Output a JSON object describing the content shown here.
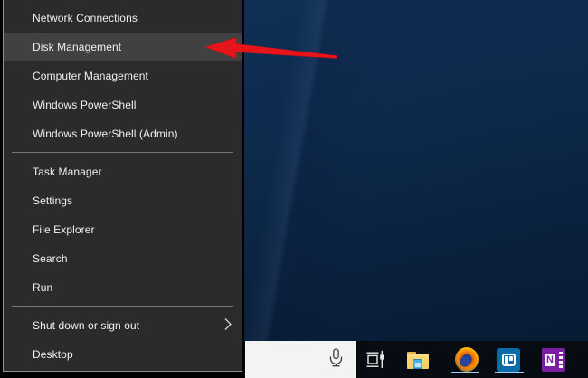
{
  "menu": {
    "groups": [
      {
        "items": [
          {
            "label": "Network Connections",
            "highlighted": false,
            "has_submenu": false
          },
          {
            "label": "Disk Management",
            "highlighted": true,
            "has_submenu": false
          },
          {
            "label": "Computer Management",
            "highlighted": false,
            "has_submenu": false
          },
          {
            "label": "Windows PowerShell",
            "highlighted": false,
            "has_submenu": false
          },
          {
            "label": "Windows PowerShell (Admin)",
            "highlighted": false,
            "has_submenu": false
          }
        ]
      },
      {
        "items": [
          {
            "label": "Task Manager",
            "highlighted": false,
            "has_submenu": false
          },
          {
            "label": "Settings",
            "highlighted": false,
            "has_submenu": false
          },
          {
            "label": "File Explorer",
            "highlighted": false,
            "has_submenu": false
          },
          {
            "label": "Search",
            "highlighted": false,
            "has_submenu": false
          },
          {
            "label": "Run",
            "highlighted": false,
            "has_submenu": false
          }
        ]
      },
      {
        "items": [
          {
            "label": "Shut down or sign out",
            "highlighted": false,
            "has_submenu": true
          },
          {
            "label": "Desktop",
            "highlighted": false,
            "has_submenu": false
          }
        ]
      }
    ]
  },
  "taskbar": {
    "search_box": {
      "icon": "microphone-icon"
    },
    "icons": [
      {
        "name": "task-view",
        "running": false
      },
      {
        "name": "file-explorer",
        "running": false
      },
      {
        "name": "firefox",
        "running": true
      },
      {
        "name": "trello",
        "running": true
      },
      {
        "name": "onenote",
        "running": false
      }
    ]
  },
  "annotation": {
    "type": "red-arrow",
    "points_to": "Disk Management"
  },
  "colors": {
    "menu_bg": "#2b2b2b",
    "menu_highlight": "#414141",
    "menu_text": "#f0f0f0",
    "menu_border": "#8f8f8f",
    "divider": "#777777",
    "desktop_blue_top": "#103158",
    "desktop_blue_bottom": "#081b33",
    "taskbar_bg": "#070b12",
    "search_box_bg": "#f3f3f1",
    "running_indicator": "#9dcbe9",
    "arrow_red": "#e8141c",
    "trello_blue": "#0c6ca8",
    "onenote_purple": "#7a1fa2"
  }
}
